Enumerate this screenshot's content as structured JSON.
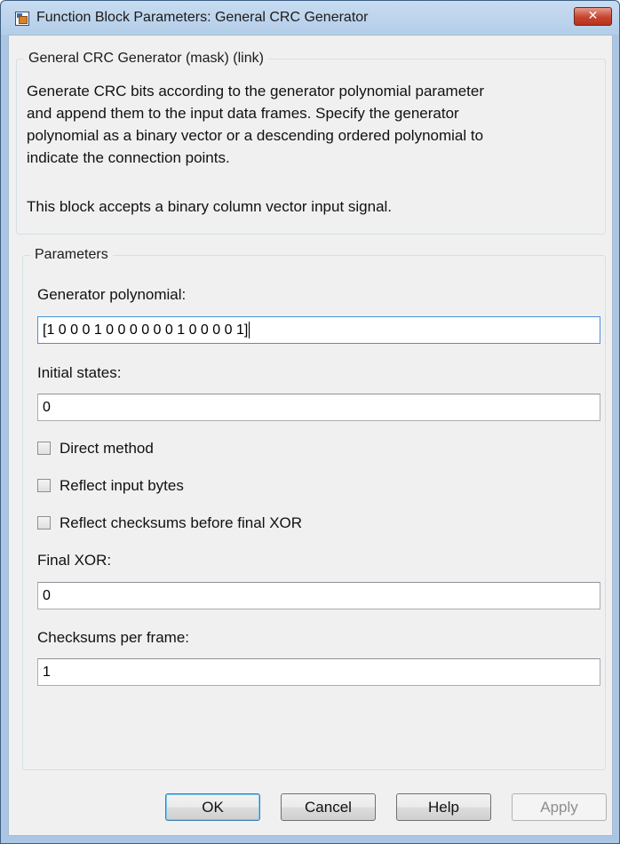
{
  "window": {
    "title": "Function Block Parameters: General CRC Generator",
    "close_label": "✕"
  },
  "description_group": {
    "legend": "General CRC Generator (mask) (link)",
    "lines": [
      "Generate CRC bits according to the generator polynomial parameter",
      "and append them to the input data frames. Specify the generator",
      "polynomial as a binary vector or a descending ordered polynomial to",
      "indicate the connection points."
    ],
    "note": "This block accepts a binary column vector input signal."
  },
  "parameters": {
    "legend": "Parameters",
    "generator_polynomial": {
      "label": "Generator polynomial:",
      "value": "[1 0 0 0 1 0 0 0 0 0 0 1 0 0 0 0 1]"
    },
    "initial_states": {
      "label": "Initial states:",
      "value": "0"
    },
    "direct_method": {
      "label": "Direct method",
      "checked": false
    },
    "reflect_input_bytes": {
      "label": "Reflect input bytes",
      "checked": false
    },
    "reflect_checksums": {
      "label": "Reflect checksums before final XOR",
      "checked": false
    },
    "final_xor": {
      "label": "Final XOR:",
      "value": "0"
    },
    "checksums_per_frame": {
      "label": "Checksums per frame:",
      "value": "1"
    }
  },
  "buttons": {
    "ok": "OK",
    "cancel": "Cancel",
    "help": "Help",
    "apply": "Apply"
  },
  "colors": {
    "accent_focus": "#4d8fd8",
    "close_button": "#c6452f"
  }
}
